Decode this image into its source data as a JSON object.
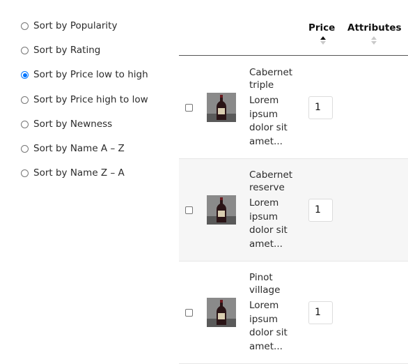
{
  "sort_options": [
    {
      "label": "Sort by Popularity",
      "selected": false
    },
    {
      "label": "Sort by Rating",
      "selected": false
    },
    {
      "label": "Sort by Price low to high",
      "selected": true
    },
    {
      "label": "Sort by Price high to low",
      "selected": false
    },
    {
      "label": "Sort by Newness",
      "selected": false
    },
    {
      "label": "Sort by Name A – Z",
      "selected": false
    },
    {
      "label": "Sort by Name Z – A",
      "selected": false
    }
  ],
  "table": {
    "headers": {
      "price": "Price",
      "attributes": "Attributes"
    },
    "price_sort": "ascending",
    "rows": [
      {
        "name": "Cabernet triple",
        "description": "Lorem ipsum dolor sit amet...",
        "quantity": "1",
        "checked": false
      },
      {
        "name": "Cabernet reserve",
        "description": "Lorem ipsum dolor sit amet...",
        "quantity": "1",
        "checked": false
      },
      {
        "name": "Pinot village",
        "description": "Lorem ipsum dolor sit amet...",
        "quantity": "1",
        "checked": false
      }
    ]
  },
  "icons": {
    "thumbnail": "wine-bottle-icon",
    "sort": "sort-arrows-icon"
  },
  "colors": {
    "radio_selected": "#0075ff",
    "alt_row": "#f6f6f6"
  }
}
